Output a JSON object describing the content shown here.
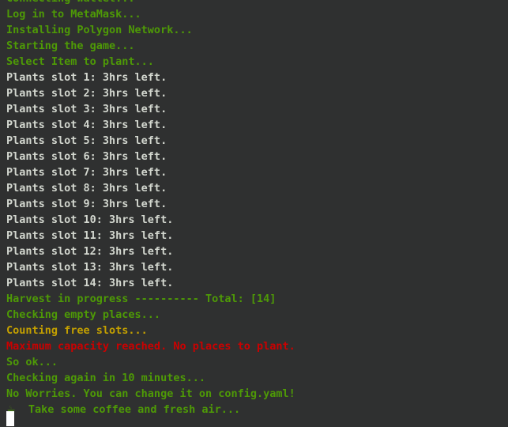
{
  "terminal": {
    "background_color": "#2f3030",
    "colors": {
      "green": "#4e9a06",
      "white": "#d3d7cf",
      "amber": "#c4a000",
      "red": "#cc0000",
      "cursor": "#ffffff"
    },
    "lines": [
      {
        "id": "line-scrolled-partial",
        "text": "Connecting wallet...",
        "color": "green",
        "partial": true
      },
      {
        "id": "line-login-metamask",
        "text": "Log in to MetaMask...",
        "color": "green"
      },
      {
        "id": "line-installing-polygon",
        "text": "Installing Polygon Network...",
        "color": "green"
      },
      {
        "id": "line-starting-game",
        "text": "Starting the game...",
        "color": "green"
      },
      {
        "id": "line-select-item",
        "text": "Select Item to plant...",
        "color": "green"
      },
      {
        "id": "line-plants-slot-1",
        "text": "Plants slot 1: 3hrs left.",
        "color": "white"
      },
      {
        "id": "line-plants-slot-2",
        "text": "Plants slot 2: 3hrs left.",
        "color": "white"
      },
      {
        "id": "line-plants-slot-3",
        "text": "Plants slot 3: 3hrs left.",
        "color": "white"
      },
      {
        "id": "line-plants-slot-4",
        "text": "Plants slot 4: 3hrs left.",
        "color": "white"
      },
      {
        "id": "line-plants-slot-5",
        "text": "Plants slot 5: 3hrs left.",
        "color": "white"
      },
      {
        "id": "line-plants-slot-6",
        "text": "Plants slot 6: 3hrs left.",
        "color": "white"
      },
      {
        "id": "line-plants-slot-7",
        "text": "Plants slot 7: 3hrs left.",
        "color": "white"
      },
      {
        "id": "line-plants-slot-8",
        "text": "Plants slot 8: 3hrs left.",
        "color": "white"
      },
      {
        "id": "line-plants-slot-9",
        "text": "Plants slot 9: 3hrs left.",
        "color": "white"
      },
      {
        "id": "line-plants-slot-10",
        "text": "Plants slot 10: 3hrs left.",
        "color": "white"
      },
      {
        "id": "line-plants-slot-11",
        "text": "Plants slot 11: 3hrs left.",
        "color": "white"
      },
      {
        "id": "line-plants-slot-12",
        "text": "Plants slot 12: 3hrs left.",
        "color": "white"
      },
      {
        "id": "line-plants-slot-13",
        "text": "Plants slot 13: 3hrs left.",
        "color": "white"
      },
      {
        "id": "line-plants-slot-14",
        "text": "Plants slot 14: 3hrs left.",
        "color": "white"
      },
      {
        "id": "line-harvest-progress",
        "text": "Harvest in progress ---------- Total: [14]",
        "color": "green"
      },
      {
        "id": "line-checking-empty-places",
        "text": "Checking empty places...",
        "color": "green"
      },
      {
        "id": "line-counting-free-slots",
        "text": "Counting free slots...",
        "color": "amber"
      },
      {
        "id": "line-maximum-capacity",
        "text": "Maximum capacity reached. No places to plant.",
        "color": "red"
      },
      {
        "id": "line-so-ok",
        "text": "So ok...",
        "color": "green"
      },
      {
        "id": "line-checking-again",
        "text": "Checking again in 10 minutes...",
        "color": "green"
      },
      {
        "id": "line-no-worries",
        "text": "No Worries. You can change it on config.yaml!",
        "color": "green"
      },
      {
        "id": "line-take-coffee",
        "text": "Take some coffee and fresh air...",
        "color": "green",
        "icon": "coffee-icon",
        "icon_glyph": "☕"
      }
    ],
    "cursor": {
      "visible": true,
      "shape": "block"
    }
  }
}
